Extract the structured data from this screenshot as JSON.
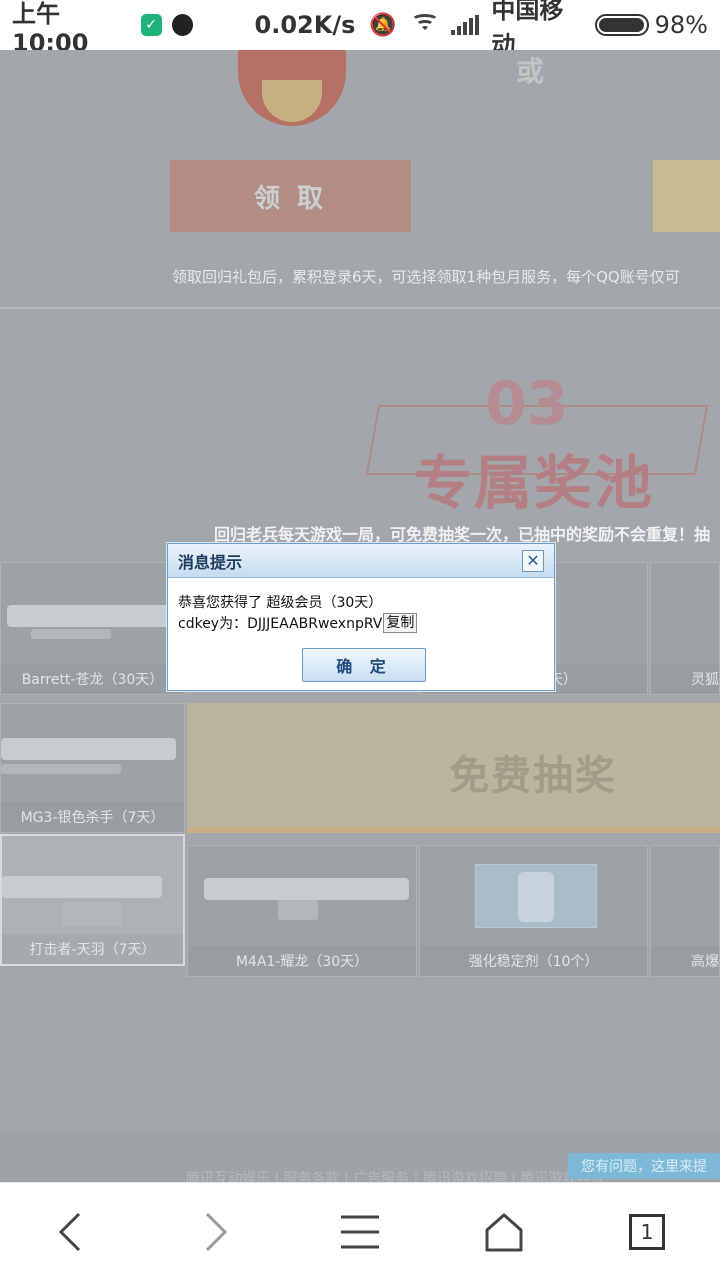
{
  "status_bar": {
    "time": "上午10:00",
    "net_speed": "0.02K/s",
    "carrier": "中国移动",
    "battery_pct": "98%",
    "battery_level": 0.98,
    "icons": [
      "security-app-icon",
      "qq-icon",
      "silent-bell-icon",
      "wifi-icon",
      "signal-icon",
      "battery-icon"
    ]
  },
  "page": {
    "or_text": "或",
    "claim_button": "领 取",
    "claim_note": "领取回归礼包后，累积登录6天，可选择领取1种包月服务，每个QQ账号仅可",
    "section_number": "03",
    "section_title": "专属奖池",
    "section_desc": "回归老兵每天游戏一局，可免费抽奖一次，已抽中的奖励不会重复！抽",
    "draw_button": "免费抽奖",
    "prizes": [
      {
        "name": "Barrett-苍龙（30天）"
      },
      {
        "name": "天）"
      },
      {
        "name": "灵狐"
      },
      {
        "name": "MG3-银色杀手（7天）"
      },
      {
        "name": "打击者-天羽（7天）"
      },
      {
        "name": "M4A1-耀龙（30天）"
      },
      {
        "name": "强化稳定剂（10个）"
      },
      {
        "name": "高爆"
      }
    ],
    "footer_links": "腾讯互动娱乐 | 服务条款 | 广告服务 | 腾讯游戏招聘 | 腾讯游戏客服",
    "help_tab": "您有问题，这里来提"
  },
  "dialog": {
    "title": "消息提示",
    "close_symbol": "✕",
    "message": "恭喜您获得了 超级会员（30天）",
    "cdkey_label": "cdkey为：DJJJEAABRwexnpRV",
    "copy_label": "复制",
    "ok_label": "确 定"
  },
  "nav": {
    "tab_count": "1"
  }
}
